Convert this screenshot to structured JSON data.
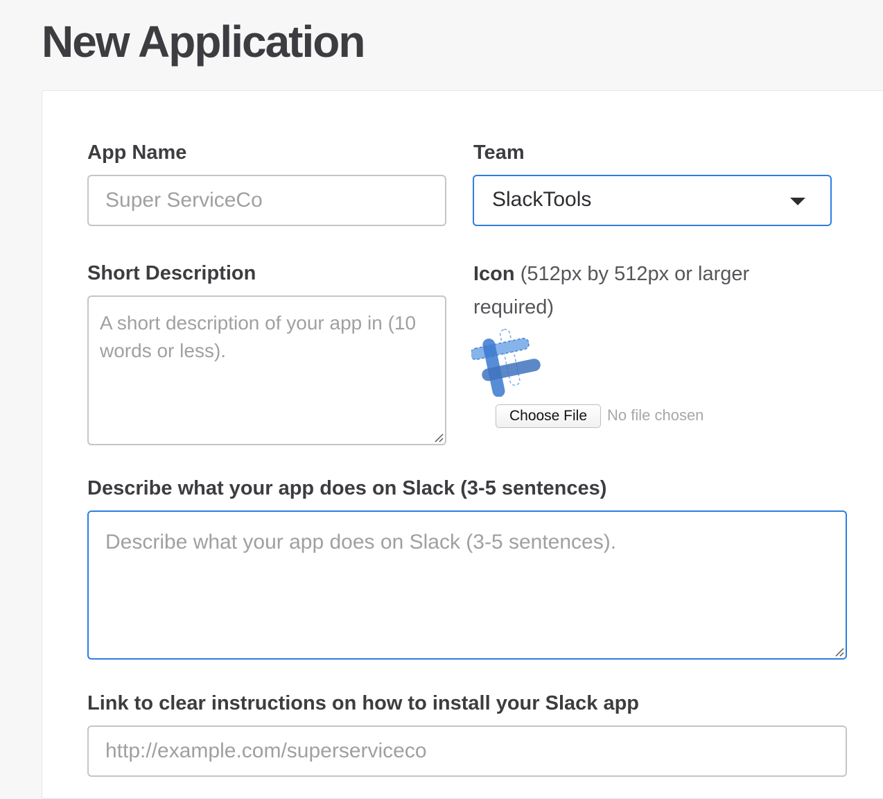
{
  "page": {
    "title": "New Application"
  },
  "form": {
    "app_name": {
      "label": "App Name",
      "placeholder": "Super ServiceCo",
      "value": ""
    },
    "team": {
      "label": "Team",
      "selected": "SlackTools"
    },
    "short_description": {
      "label": "Short Description",
      "placeholder": "A short description of your app in (10 words or less)."
    },
    "icon": {
      "label": "Icon",
      "hint": "(512px by 512px or larger required)",
      "choose_file_label": "Choose File",
      "file_status": "No file chosen"
    },
    "long_description": {
      "label": "Describe what your app does on Slack (3-5 sentences)",
      "placeholder": "Describe what your app does on Slack (3-5 sentences)."
    },
    "install_link": {
      "label": "Link to clear instructions on how to install your Slack app",
      "placeholder": "http://example.com/superserviceco"
    }
  },
  "colors": {
    "focus_border": "#2d7de0",
    "input_border": "#c5c5c7",
    "placeholder": "#a0a0a2",
    "page_background": "#f7f7f7"
  },
  "icons": {
    "app_icon": "slack-hash-logo-icon",
    "dropdown": "caret-down-icon"
  }
}
